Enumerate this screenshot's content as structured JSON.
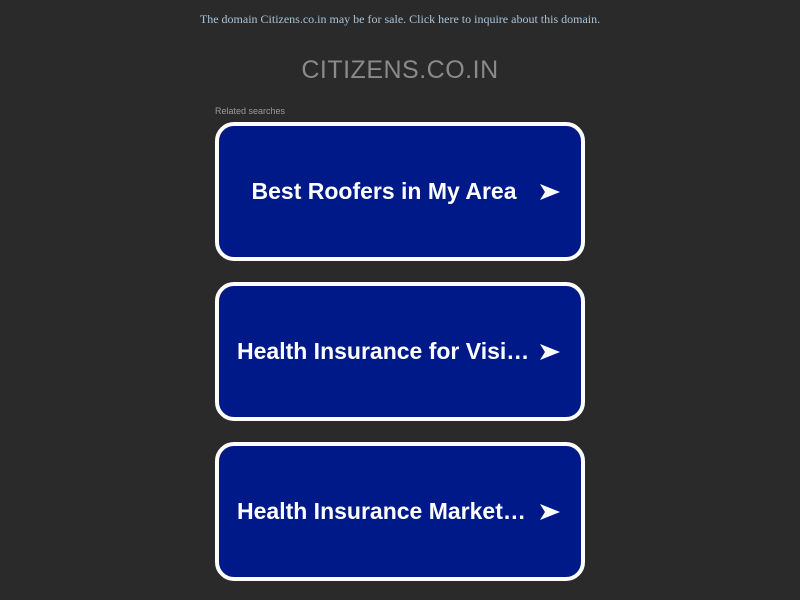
{
  "header": {
    "sale_notice": "The domain Citizens.co.in may be for sale. Click here to inquire about this domain.",
    "domain_title": "CITIZENS.CO.IN"
  },
  "related": {
    "label": "Related searches",
    "items": [
      {
        "label": "Best Roofers in My Area"
      },
      {
        "label": "Health Insurance for Visitors"
      },
      {
        "label": "Health Insurance Marketplace"
      }
    ]
  },
  "icons": {
    "result_arrow": "arrow-right-icon"
  },
  "colors": {
    "background": "#2a2a2a",
    "notice_text": "#a7c4d9",
    "title_text": "#8a8a8a",
    "button_fill": "#001989",
    "button_border": "#ffffff",
    "button_text": "#ffffff"
  }
}
